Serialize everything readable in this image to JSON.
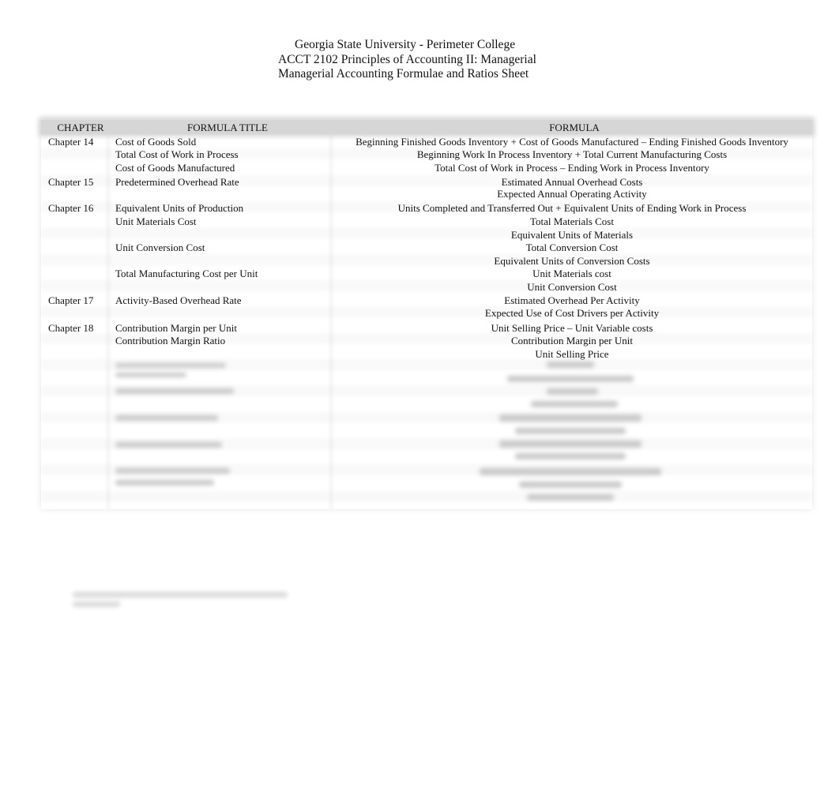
{
  "header": {
    "institution": "Georgia State University - Perimeter College",
    "course": "ACCT 2102 Principles of Accounting II: Managerial",
    "sheet_title": "Managerial Accounting Formulae and Ratios Sheet"
  },
  "table": {
    "columns": {
      "chapter": "CHAPTER",
      "title": "FORMULA TITLE",
      "formula": "FORMULA"
    },
    "rows": [
      {
        "chapter": "Chapter 14",
        "title": "Cost of Goods Sold",
        "formula": "Beginning Finished Goods Inventory + Cost of Goods Manufactured – Ending Finished Goods Inventory"
      },
      {
        "chapter": "",
        "title": "Total Cost of Work in Process",
        "formula": "Beginning Work In Process Inventory + Total Current Manufacturing Costs"
      },
      {
        "chapter": "",
        "title": "Cost of Goods Manufactured",
        "formula": "Total Cost of Work in Process – Ending Work in Process Inventory"
      },
      {
        "chapter": "Chapter 15",
        "title": "Predetermined Overhead Rate",
        "numerator": "Estimated Annual Overhead Costs",
        "denominator": "Expected Annual Operating Activity"
      },
      {
        "chapter": "Chapter 16",
        "title": "Equivalent Units of Production",
        "formula": "Units Completed and Transferred Out + Equivalent Units of Ending Work in Process"
      },
      {
        "chapter": "",
        "title": "Unit Materials Cost",
        "numerator": "Total Materials Cost",
        "denominator": "Equivalent Units of Materials"
      },
      {
        "chapter": "",
        "title": "Unit Conversion Cost",
        "numerator": "Total Conversion Cost",
        "denominator": "Equivalent Units of Conversion Costs"
      },
      {
        "chapter": "",
        "title": "Total Manufacturing Cost per Unit",
        "numerator": "Unit Materials cost",
        "denominator": "Unit Conversion Cost"
      },
      {
        "chapter": "Chapter 17",
        "title": "Activity-Based Overhead Rate",
        "numerator": "Estimated Overhead Per Activity",
        "denominator": "Expected Use of Cost Drivers per Activity"
      },
      {
        "chapter": "Chapter 18",
        "title": "Contribution Margin per Unit",
        "formula": "Unit Selling Price – Unit Variable costs"
      },
      {
        "chapter": "",
        "title": "Contribution Margin Ratio",
        "numerator": "Contribution Margin per Unit",
        "denominator": "Unit Selling Price"
      }
    ]
  }
}
